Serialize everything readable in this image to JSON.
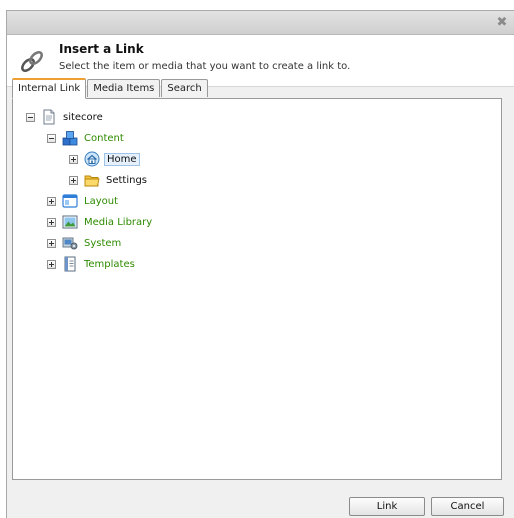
{
  "dialog": {
    "close_glyph": "✖",
    "title": "Insert a Link",
    "subtitle": "Select the item or media that you want to create a link to."
  },
  "tabs": [
    {
      "label": "Internal Link",
      "active": true
    },
    {
      "label": "Media Items",
      "active": false
    },
    {
      "label": "Search",
      "active": false
    }
  ],
  "tree": {
    "sitecore": "sitecore",
    "content": "Content",
    "home": "Home",
    "settings": "Settings",
    "layout": "Layout",
    "media_library": "Media Library",
    "system": "System",
    "templates": "Templates",
    "selected": "Home"
  },
  "buttons": {
    "link": "Link",
    "cancel": "Cancel"
  },
  "colors": {
    "tree_link_green": "#2e8b00",
    "active_tab_accent": "#f0a030",
    "selection_bg": "#e6f0fb"
  },
  "icons": {
    "header": "link-chain-icon",
    "sitecore": "document-icon",
    "content": "content-cubes-icon",
    "home": "home-icon",
    "settings": "folder-icon",
    "layout": "layout-window-icon",
    "media_library": "media-image-icon",
    "system": "system-gear-icon",
    "templates": "template-document-icon"
  }
}
